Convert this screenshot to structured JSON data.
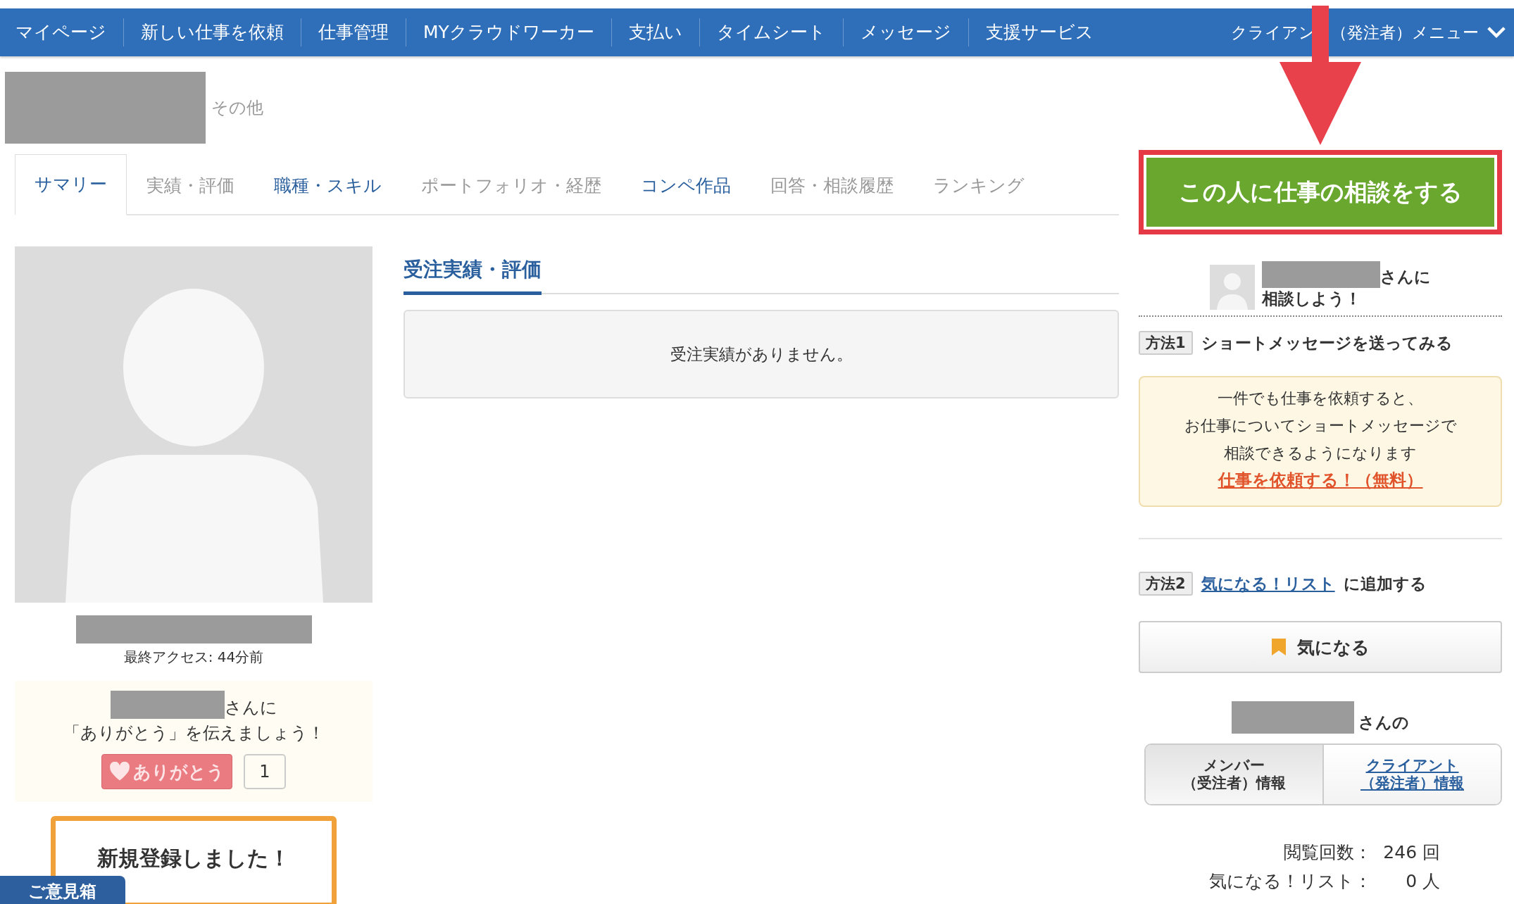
{
  "nav": {
    "items": [
      {
        "label": "マイページ"
      },
      {
        "label": "新しい仕事を依頼"
      },
      {
        "label": "仕事管理"
      },
      {
        "label": "MYクラウドワーカー"
      },
      {
        "label": "支払い"
      },
      {
        "label": "タイムシート"
      },
      {
        "label": "メッセージ"
      },
      {
        "label": "支援サービス"
      }
    ],
    "menu": {
      "label_start": "クライアン",
      "label_end": "（発注者）メニュー"
    }
  },
  "profile": {
    "category": "その他"
  },
  "tabs": [
    {
      "label": "サマリー",
      "selected": true,
      "disabled": false
    },
    {
      "label": "実績・評価",
      "selected": false,
      "disabled": true
    },
    {
      "label": "職種・スキル",
      "selected": false,
      "disabled": false
    },
    {
      "label": "ポートフォリオ・経歴",
      "selected": false,
      "disabled": true
    },
    {
      "label": "コンペ作品",
      "selected": false,
      "disabled": false
    },
    {
      "label": "回答・相談履歴",
      "selected": false,
      "disabled": true
    },
    {
      "label": "ランキング",
      "selected": false,
      "disabled": true
    }
  ],
  "consult_button": {
    "label": "この人に仕事の相談をする"
  },
  "left": {
    "last_access": "最終アクセス: 44分前",
    "thanks": {
      "suffix": "さんに",
      "message": "「ありがとう」を伝えましょう！",
      "button": "ありがとう",
      "count": "1"
    },
    "badge": "新規登録しました！"
  },
  "main": {
    "heading": "受注実績・評価",
    "empty": "受注実績がありません。"
  },
  "side": {
    "consult": {
      "suffix": "さんに",
      "line2": "相談しよう！"
    },
    "method1": {
      "badge": "方法1",
      "text": "ショートメッセージを送ってみる"
    },
    "notice": {
      "lines": [
        "一件でも仕事を依頼すると、",
        "お仕事についてショートメッセージで",
        "相談できるようになります"
      ],
      "link": "仕事を依頼する！（無料）"
    },
    "method2": {
      "badge": "方法2",
      "link": "気になる！リスト",
      "text": "に追加する"
    },
    "watch_button": {
      "label": "気になる"
    },
    "info": {
      "suffix": "さんの",
      "segments": [
        {
          "lines": [
            "メンバー",
            "（受注者）情報"
          ],
          "selected": true
        },
        {
          "lines": [
            "クライアント",
            "（発注者）情報"
          ],
          "selected": false
        }
      ]
    },
    "stats": [
      {
        "label": "閲覧回数：",
        "value": "246 回"
      },
      {
        "label": "気になる！リスト：",
        "value": "0 人"
      }
    ]
  },
  "feedback_tab": {
    "label": "ご意見箱"
  }
}
